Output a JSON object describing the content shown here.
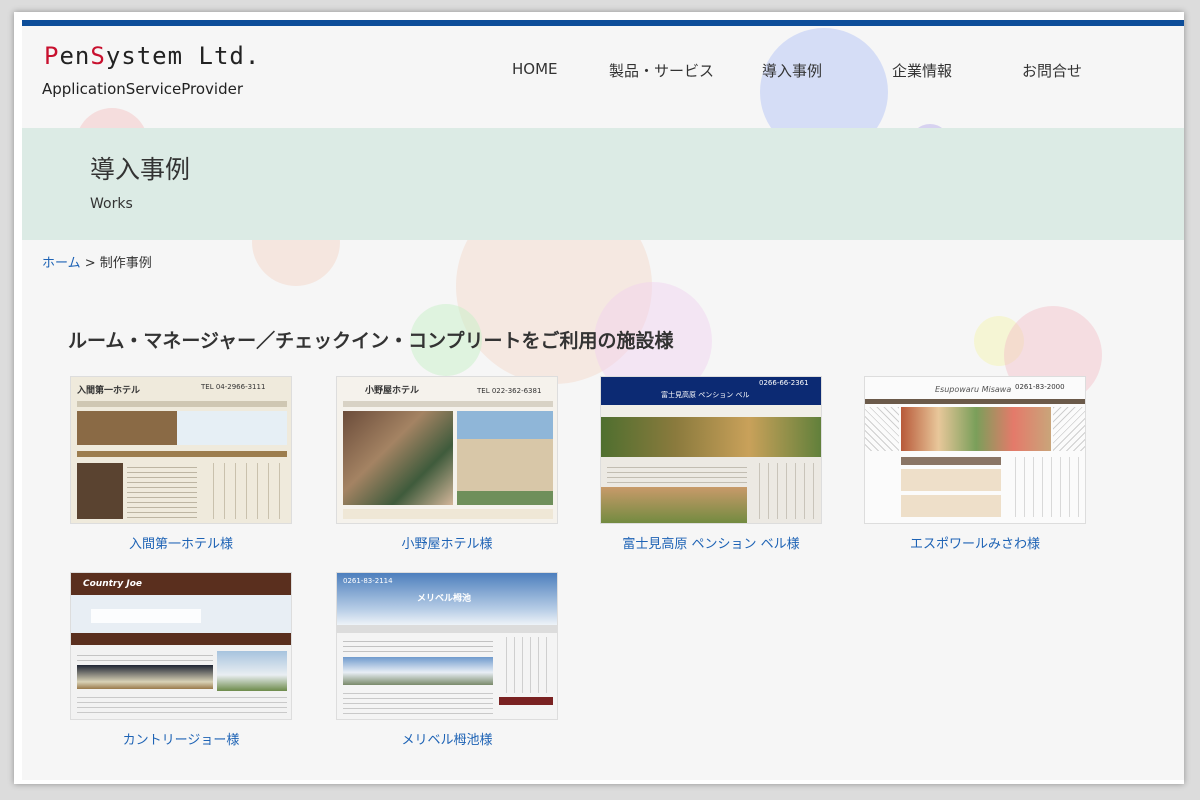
{
  "brand": {
    "logo_part1": "P",
    "logo_part2": "en",
    "logo_part3": "S",
    "logo_part4": "ystem  Ltd.",
    "tagline": "ApplicationServiceProvider"
  },
  "nav": {
    "items": [
      {
        "label": "HOME"
      },
      {
        "label": "製品・サービス"
      },
      {
        "label": "導入事例"
      },
      {
        "label": "企業情報"
      },
      {
        "label": "お問合せ"
      }
    ]
  },
  "hero": {
    "title": "導入事例",
    "subtitle": "Works"
  },
  "breadcrumb": {
    "home": "ホーム",
    "separator": " > ",
    "current": "制作事例"
  },
  "section": {
    "title": "ルーム・マネージャー／チェックイン・コンプリートをご利用の施設様"
  },
  "cases": [
    {
      "caption": "入間第一ホテル様",
      "thumb_title": "入間第一ホテル",
      "thumb_phone": "TEL 04-2966-3111"
    },
    {
      "caption": "小野屋ホテル様",
      "thumb_title": "小野屋ホテル",
      "thumb_phone": "TEL 022-362-6381"
    },
    {
      "caption": "富士見高原 ペンション ベル様",
      "thumb_title": "富士見高原 ペンション ベル",
      "thumb_phone": "0266-66-2361"
    },
    {
      "caption": "エスポワールみさわ様",
      "thumb_title": "Esupowaru Misawa",
      "thumb_phone": "0261-83-2000"
    },
    {
      "caption": "カントリージョー様",
      "thumb_title": "Country Joe",
      "thumb_phone": ""
    },
    {
      "caption": "メリベル栂池様",
      "thumb_title": "メリベル栂池",
      "thumb_phone": "0261-83-2114"
    }
  ],
  "colors": {
    "topbar": "#0d4d99",
    "link": "#1e63b5",
    "hero_bg": "#dcebe5",
    "logo_accent": "#c8102e"
  }
}
